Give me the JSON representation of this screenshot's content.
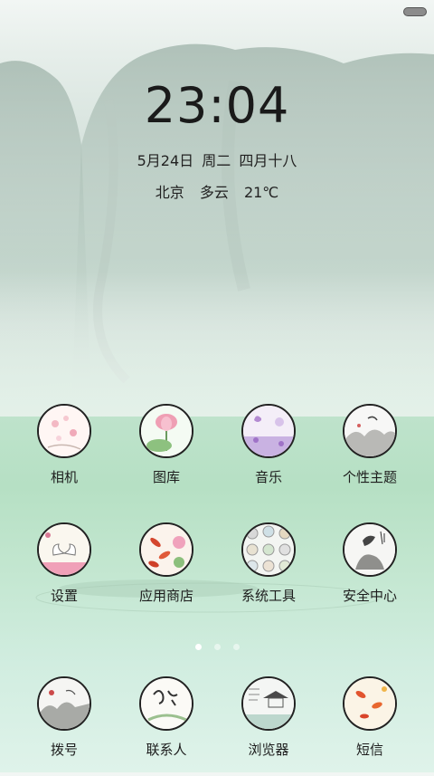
{
  "lockscreen": {
    "time": "23:04",
    "date": "5月24日",
    "weekday": "周二",
    "lunar": "四月十八",
    "city": "北京",
    "condition": "多云",
    "temperature": "21℃"
  },
  "apps_row1": [
    {
      "label": "相机",
      "icon": "lotus-blossom-icon"
    },
    {
      "label": "图库",
      "icon": "pink-lotus-icon"
    },
    {
      "label": "音乐",
      "icon": "purple-butterfly-icon"
    },
    {
      "label": "个性主题",
      "icon": "ink-landscape-icon"
    }
  ],
  "apps_row2": [
    {
      "label": "设置",
      "icon": "swans-icon"
    },
    {
      "label": "应用商店",
      "icon": "koi-fish-icon"
    },
    {
      "label": "系统工具",
      "icon": "tools-folder-icon"
    },
    {
      "label": "安全中心",
      "icon": "ink-bamboo-icon"
    }
  ],
  "dock": [
    {
      "label": "拨号",
      "icon": "ink-mountain-icon"
    },
    {
      "label": "联系人",
      "icon": "calligraphy-icon"
    },
    {
      "label": "浏览器",
      "icon": "pavilion-icon"
    },
    {
      "label": "短信",
      "icon": "goldfish-icon"
    }
  ],
  "pager": {
    "pages": 3,
    "active_page": 1
  },
  "colors": {
    "text": "#1d1d1d",
    "icon_border": "#222222",
    "water": "#b6e0c4"
  }
}
